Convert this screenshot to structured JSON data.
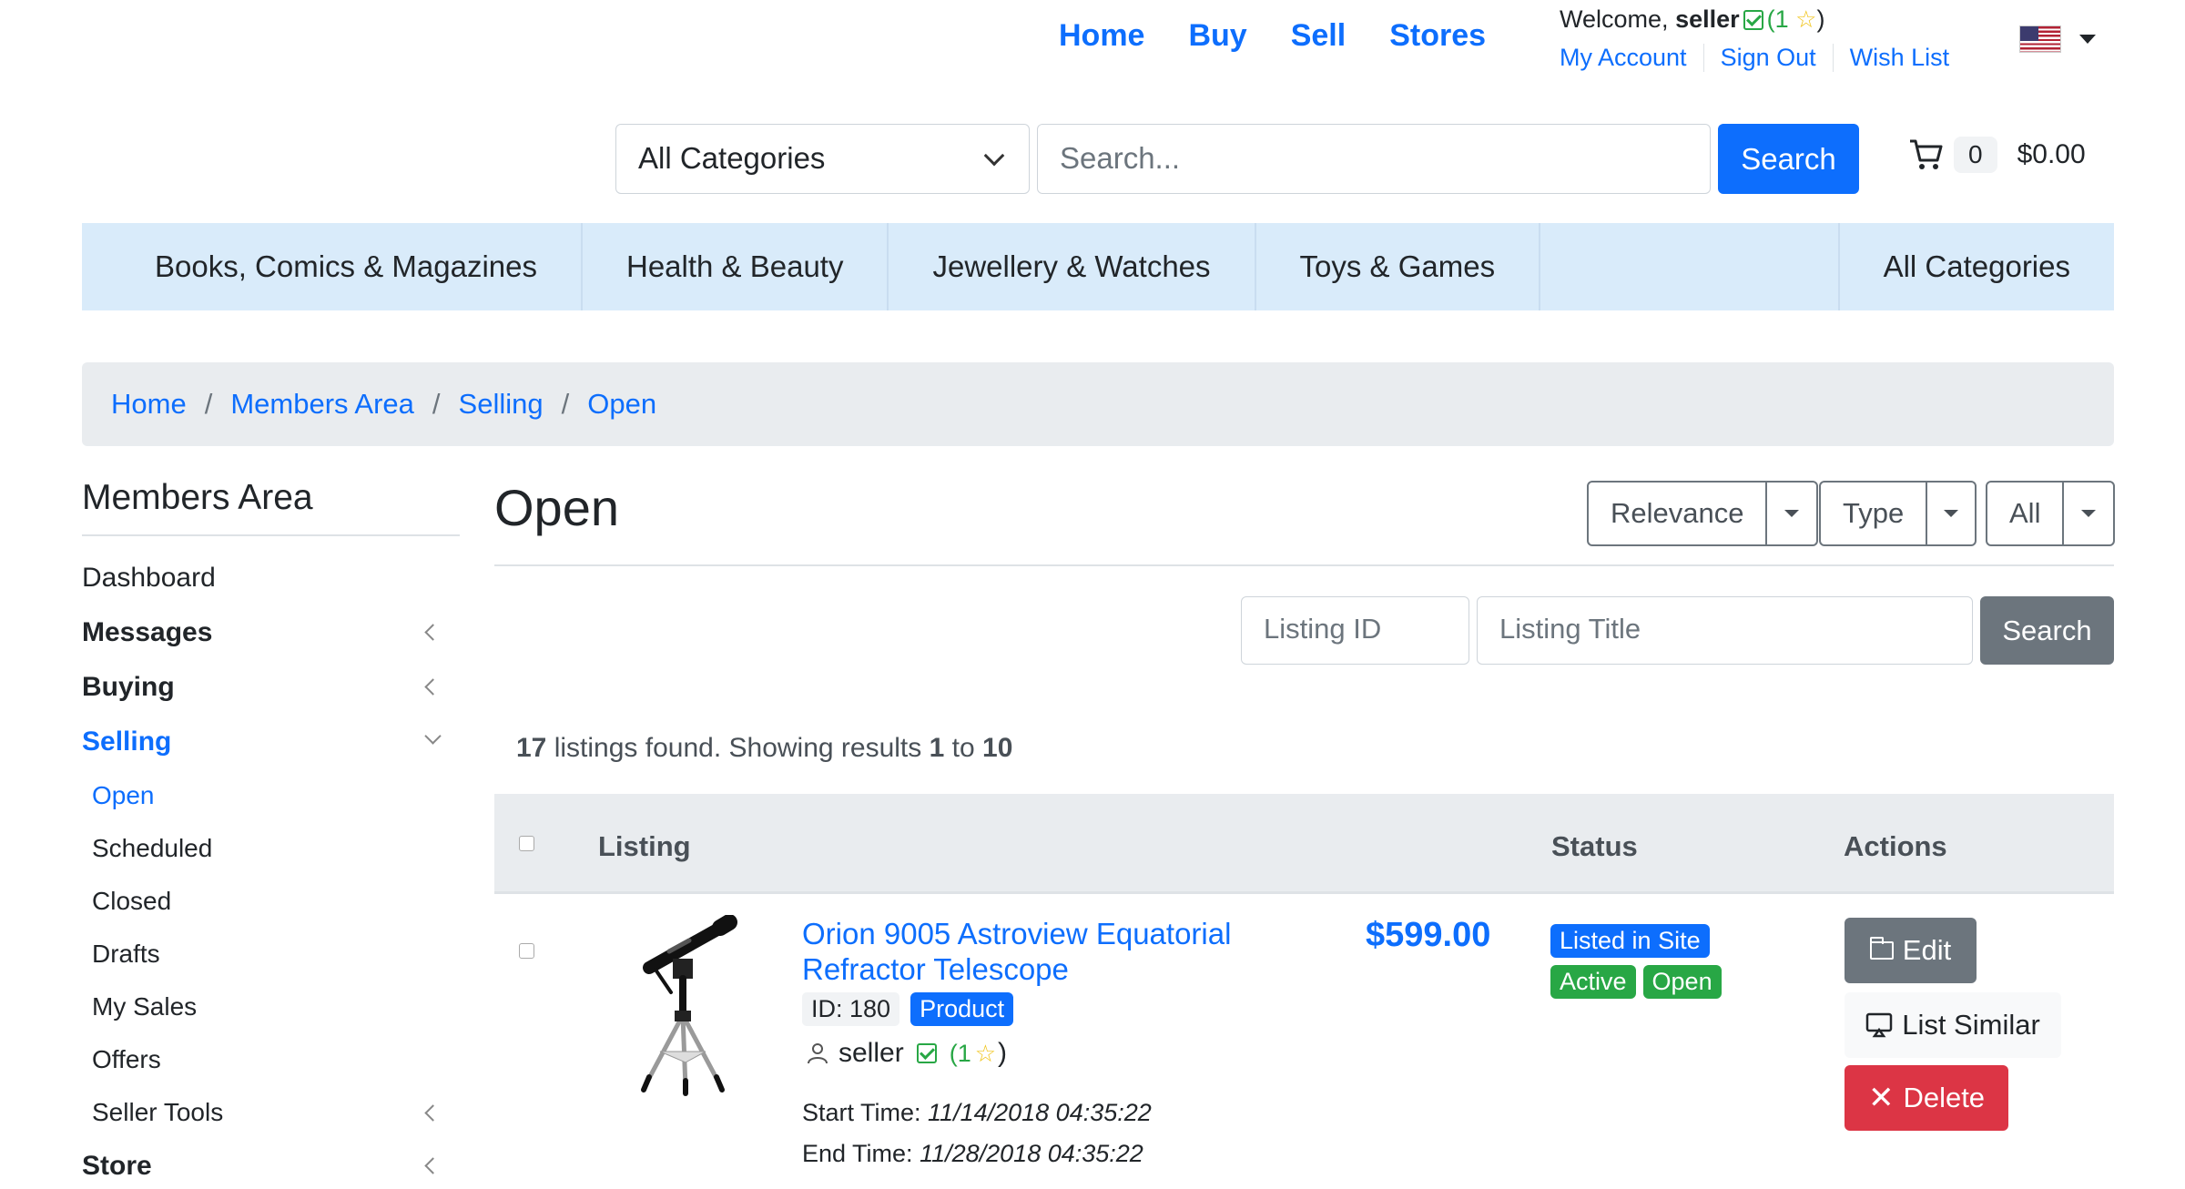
{
  "topnav": {
    "items": [
      "Home",
      "Buy",
      "Sell",
      "Stores"
    ]
  },
  "account": {
    "welcome_prefix": "Welcome,",
    "username": "seller",
    "rating_open": "(1",
    "rating_close": ")",
    "links": [
      "My Account",
      "Sign Out",
      "Wish List"
    ]
  },
  "icons": {
    "flag": "us-flag-icon",
    "cart": "cart-icon",
    "user": "user-icon"
  },
  "search": {
    "category": "All Categories",
    "placeholder": "Search...",
    "button": "Search"
  },
  "cart": {
    "count": "0",
    "total": "$0.00"
  },
  "categories": [
    "Books, Comics & Magazines",
    "Health & Beauty",
    "Jewellery & Watches",
    "Toys & Games",
    "All Categories"
  ],
  "breadcrumb": [
    "Home",
    "Members Area",
    "Selling",
    "Open"
  ],
  "sidebar": {
    "title": "Members Area",
    "items": [
      "Dashboard",
      "Messages",
      "Buying",
      "Selling"
    ],
    "selling_sub": [
      "Open",
      "Scheduled",
      "Closed",
      "Drafts",
      "My Sales",
      "Offers",
      "Seller Tools"
    ],
    "last": "Store"
  },
  "main": {
    "title": "Open",
    "sort_dropdowns": [
      "Relevance",
      "Type",
      "All"
    ],
    "listing_id_placeholder": "Listing ID",
    "listing_title_placeholder": "Listing Title",
    "filter_button": "Search",
    "found_count": "17",
    "found_text": "listings found. Showing results",
    "from": "1",
    "to_word": "to",
    "to": "10"
  },
  "table": {
    "headers": [
      "Listing",
      "Status",
      "Actions"
    ],
    "rows": [
      {
        "title": "Orion 9005 Astroview Equatorial Refractor Telescope",
        "id_label": "ID: 180",
        "type_badge": "Product",
        "seller": "seller",
        "rating_open": "(1",
        "rating_close": ")",
        "start_label": "Start Time:",
        "start_time": "11/14/2018 04:35:22",
        "end_label": "End Time:",
        "end_time": "11/28/2018 04:35:22",
        "price": "$599.00",
        "status": [
          "Listed in Site",
          "Active",
          "Open"
        ],
        "actions": [
          "Edit",
          "List Similar",
          "Delete"
        ]
      }
    ]
  },
  "colors": {
    "primary": "#0d6efd",
    "success": "#28a745",
    "danger": "#dc3545",
    "secondary": "#6c757d",
    "catbar": "#d9ebfa"
  }
}
